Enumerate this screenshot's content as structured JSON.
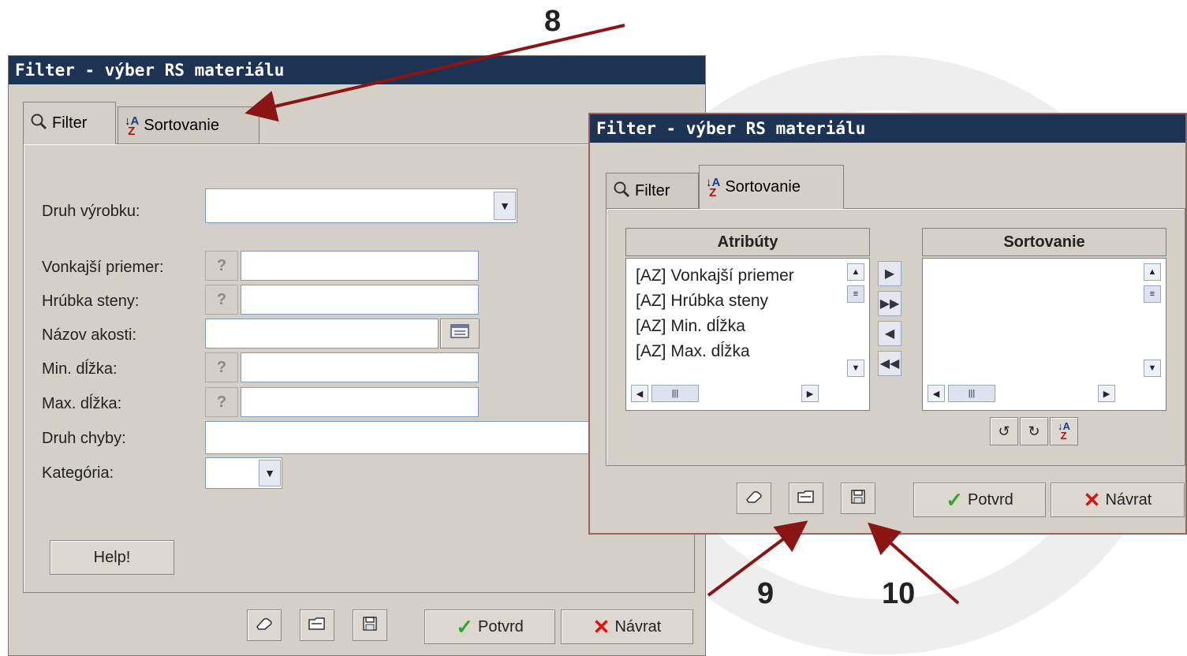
{
  "window_title": "Filter - výber RS materiálu",
  "tabs": {
    "filter": "Filter",
    "sort": "Sortovanie"
  },
  "form": {
    "druh_vyrobku": "Druh výrobku:",
    "vonkajsi_priemer": "Vonkajší priemer:",
    "hrubka_steny": "Hrúbka steny:",
    "nazov_akosti": "Názov akosti:",
    "min_dlzka": "Min. dĺžka:",
    "max_dlzka": "Max. dĺžka:",
    "druh_chyby": "Druh chyby:",
    "kategoria": "Kategória:",
    "question_mark": "?"
  },
  "buttons": {
    "help": "Help!",
    "confirm": "Potvrd",
    "back": "Návrat"
  },
  "sort_panel": {
    "attributes_header": "Atribúty",
    "sort_header": "Sortovanie",
    "attributes": [
      "[AZ] Vonkajší priemer",
      "[AZ] Hrúbka steny",
      "[AZ] Min. dĺžka",
      "[AZ] Max. dĺžka"
    ]
  },
  "annotations": {
    "a8": "8",
    "a9": "9",
    "a10": "10"
  },
  "colors": {
    "titlebar": "#1c3354",
    "arrow": "#8b1515",
    "dialog_bg": "#d4d0c8"
  }
}
